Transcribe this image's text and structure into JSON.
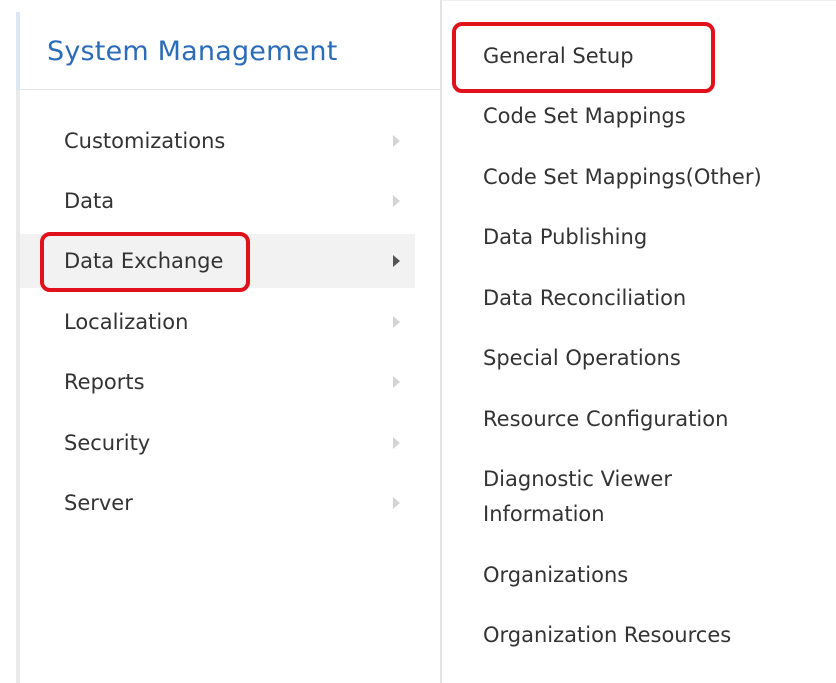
{
  "left_panel": {
    "title": "System Management",
    "items": [
      {
        "label": "Customizations",
        "has_submenu": true,
        "active": false
      },
      {
        "label": "Data",
        "has_submenu": true,
        "active": false
      },
      {
        "label": "Data Exchange",
        "has_submenu": true,
        "active": true
      },
      {
        "label": "Localization",
        "has_submenu": true,
        "active": false
      },
      {
        "label": "Reports",
        "has_submenu": true,
        "active": false
      },
      {
        "label": "Security",
        "has_submenu": true,
        "active": false
      },
      {
        "label": "Server",
        "has_submenu": true,
        "active": false
      }
    ]
  },
  "submenu": {
    "items": [
      {
        "label": "General Setup"
      },
      {
        "label": "Code Set Mappings"
      },
      {
        "label": "Code Set Mappings(Other)"
      },
      {
        "label": "Data Publishing"
      },
      {
        "label": "Data Reconciliation"
      },
      {
        "label": "Special Operations"
      },
      {
        "label": "Resource Configuration"
      },
      {
        "label": "Diagnostic Viewer Information"
      },
      {
        "label": "Organizations"
      },
      {
        "label": "Organization Resources"
      }
    ]
  },
  "colors": {
    "title": "#2b6cb8",
    "highlight": "#e0111b",
    "active_bg": "#f2f2f2",
    "text": "#333333"
  }
}
